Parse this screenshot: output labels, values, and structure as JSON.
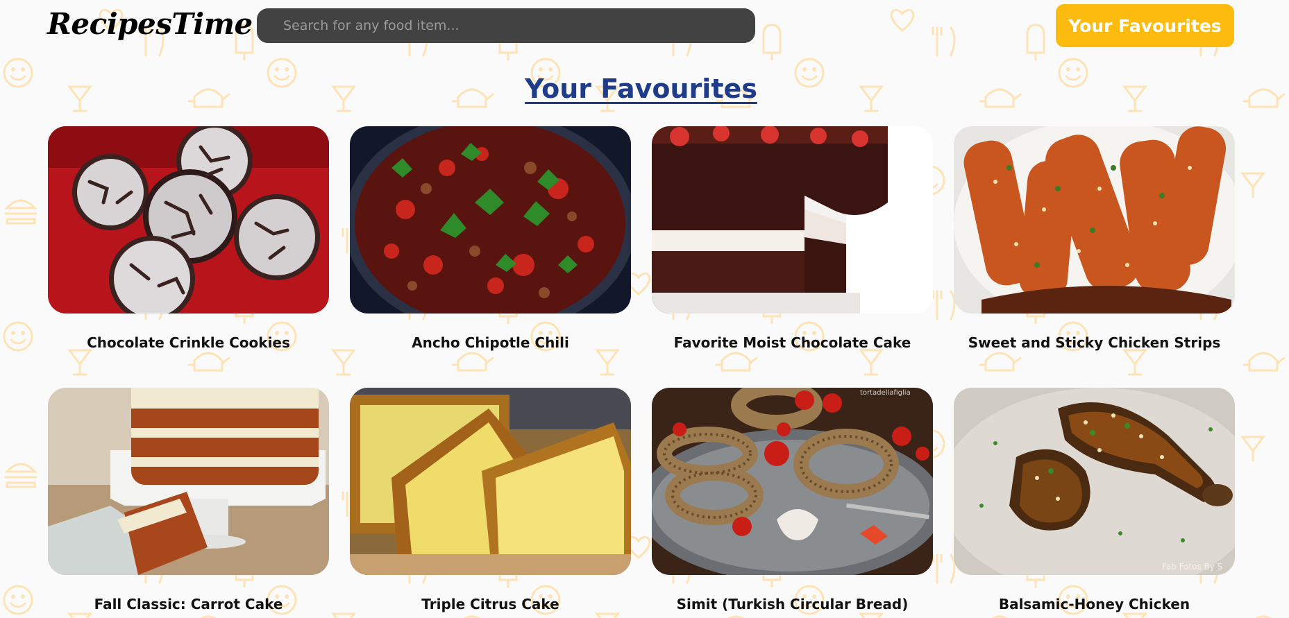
{
  "header": {
    "logo": "RecipesTime",
    "search_placeholder": "Search for any food item...",
    "favourites_button": "Your Favourites"
  },
  "page_title": "Your Favourites",
  "colors": {
    "accent": "#fdba0f",
    "title_blue": "#1f3c88",
    "search_bg": "#424242",
    "pattern": "#fde3b5"
  },
  "recipes": [
    {
      "title": "Chocolate Crinkle Cookies",
      "image": "chocolate-crinkle-cookies-photo"
    },
    {
      "title": "Ancho Chipotle Chili",
      "image": "ancho-chipotle-chili-photo"
    },
    {
      "title": "Favorite Moist Chocolate Cake",
      "image": "chocolate-cake-photo"
    },
    {
      "title": "Sweet and Sticky Chicken Strips",
      "image": "chicken-strips-photo"
    },
    {
      "title": "Fall Classic: Carrot Cake",
      "image": "carrot-cake-photo"
    },
    {
      "title": "Triple Citrus Cake",
      "image": "citrus-cake-photo"
    },
    {
      "title": "Simit (Turkish Circular Bread)",
      "image": "simit-bread-photo"
    },
    {
      "title": "Balsamic-Honey Chicken",
      "image": "balsamic-chicken-photo"
    }
  ],
  "watermarks": {
    "simit": "tortadellafiglia",
    "balsamic": "Fab Fotos By S"
  }
}
